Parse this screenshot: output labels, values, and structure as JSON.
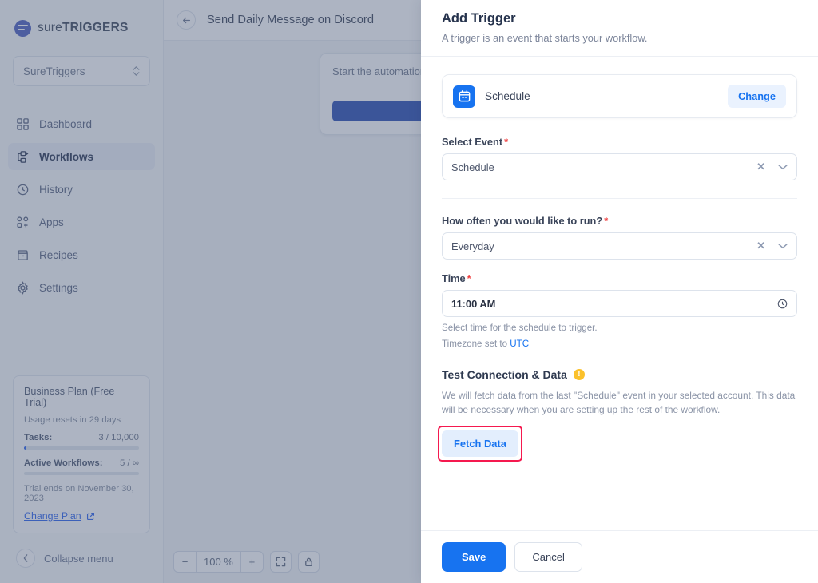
{
  "brand": {
    "logo_light": "sure",
    "logo_bold": "TRIGGERS",
    "accent": "#1773f0",
    "logo_color": "#5a6bc4"
  },
  "sidebar": {
    "workspace": {
      "name": "SureTriggers"
    },
    "items": [
      {
        "label": "Dashboard",
        "icon": "grid-icon",
        "active": false
      },
      {
        "label": "Workflows",
        "icon": "workflow-icon",
        "active": true
      },
      {
        "label": "History",
        "icon": "history-icon",
        "active": false
      },
      {
        "label": "Apps",
        "icon": "apps-icon",
        "active": false
      },
      {
        "label": "Recipes",
        "icon": "recipes-icon",
        "active": false
      },
      {
        "label": "Settings",
        "icon": "gear-icon",
        "active": false
      }
    ],
    "plan": {
      "title": "Business Plan (Free Trial)",
      "usage_reset": "Usage resets in 29 days",
      "meters": [
        {
          "label": "Tasks:",
          "value": "3 / 10,000",
          "percent": 2
        },
        {
          "label": "Active Workflows:",
          "value": "5 / ∞",
          "percent": 0
        }
      ],
      "trial_end": "Trial ends on November 30, 2023",
      "change_plan": "Change Plan"
    },
    "collapse": "Collapse menu"
  },
  "main": {
    "title": "Send Daily Message on Discord",
    "node_card": {
      "head": "Start the automation w"
    },
    "zoom": {
      "minus": "−",
      "level": "100 %",
      "plus": "+"
    }
  },
  "panel": {
    "title": "Add Trigger",
    "subtitle": "A trigger is an event that starts your workflow.",
    "app_card": {
      "name": "Schedule",
      "icon": "calendar-icon",
      "change_label": "Change"
    },
    "fields": [
      {
        "label": "Select Event",
        "required": true,
        "value": "Schedule"
      },
      {
        "label": "How often you would like to run?",
        "required": true,
        "value": "Everyday"
      }
    ],
    "time_field": {
      "label": "Time",
      "required": true,
      "value": "11:00 AM",
      "hint": "Select time for the schedule to trigger.",
      "timezone_prefix": "Timezone set to ",
      "timezone": "UTC"
    },
    "test_section": {
      "title": "Test Connection & Data",
      "description": "We will fetch data from the last \"Schedule\" event in your selected account. This data will be necessary when you are setting up the rest of the workflow.",
      "fetch_label": "Fetch Data",
      "highlight_color": "#f5194f"
    },
    "footer": {
      "save": "Save",
      "cancel": "Cancel"
    }
  }
}
